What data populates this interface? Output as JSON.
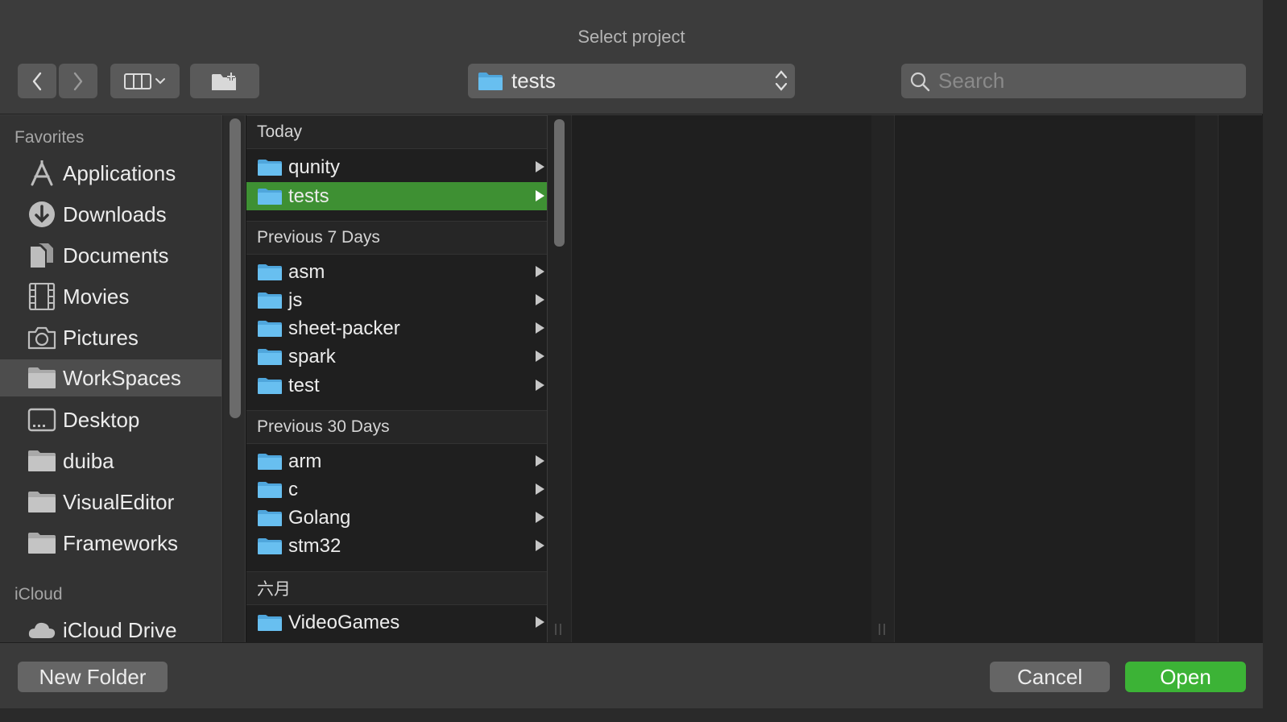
{
  "window": {
    "title": "Select project"
  },
  "toolbar": {
    "back_icon": "chevron-left-icon",
    "forward_icon": "chevron-right-icon",
    "view_icon": "columns-view-icon",
    "new_folder_icon": "folder-plus-icon",
    "path_value": "tests",
    "search_placeholder": "Search"
  },
  "sidebar": {
    "favorites_label": "Favorites",
    "favorites": [
      {
        "label": "Applications",
        "icon": "applications-icon"
      },
      {
        "label": "Downloads",
        "icon": "download-icon"
      },
      {
        "label": "Documents",
        "icon": "documents-icon"
      },
      {
        "label": "Movies",
        "icon": "film-icon"
      },
      {
        "label": "Pictures",
        "icon": "camera-icon"
      },
      {
        "label": "WorkSpaces",
        "icon": "folder-icon",
        "selected": true
      },
      {
        "label": "Desktop",
        "icon": "desktop-icon"
      },
      {
        "label": "duiba",
        "icon": "folder-icon"
      },
      {
        "label": "VisualEditor",
        "icon": "folder-icon"
      },
      {
        "label": "Frameworks",
        "icon": "folder-icon"
      }
    ],
    "icloud_label": "iCloud",
    "icloud": [
      {
        "label": "iCloud Drive",
        "icon": "cloud-icon"
      }
    ]
  },
  "browser": {
    "groups": [
      {
        "header": "Today",
        "items": [
          "qunity",
          "tests"
        ]
      },
      {
        "header": "Previous 7 Days",
        "items": [
          "asm",
          "js",
          "sheet-packer",
          "spark",
          "test"
        ]
      },
      {
        "header": "Previous 30 Days",
        "items": [
          "arm",
          "c",
          "Golang",
          "stm32"
        ]
      },
      {
        "header": "六月",
        "items": [
          "VideoGames"
        ]
      }
    ],
    "selected_item": "tests"
  },
  "footer": {
    "new_folder_label": "New Folder",
    "cancel_label": "Cancel",
    "open_label": "Open"
  },
  "colors": {
    "selection_green": "#3e9033",
    "open_button": "#3cb336",
    "folder_blue": "#5fb4e6"
  }
}
